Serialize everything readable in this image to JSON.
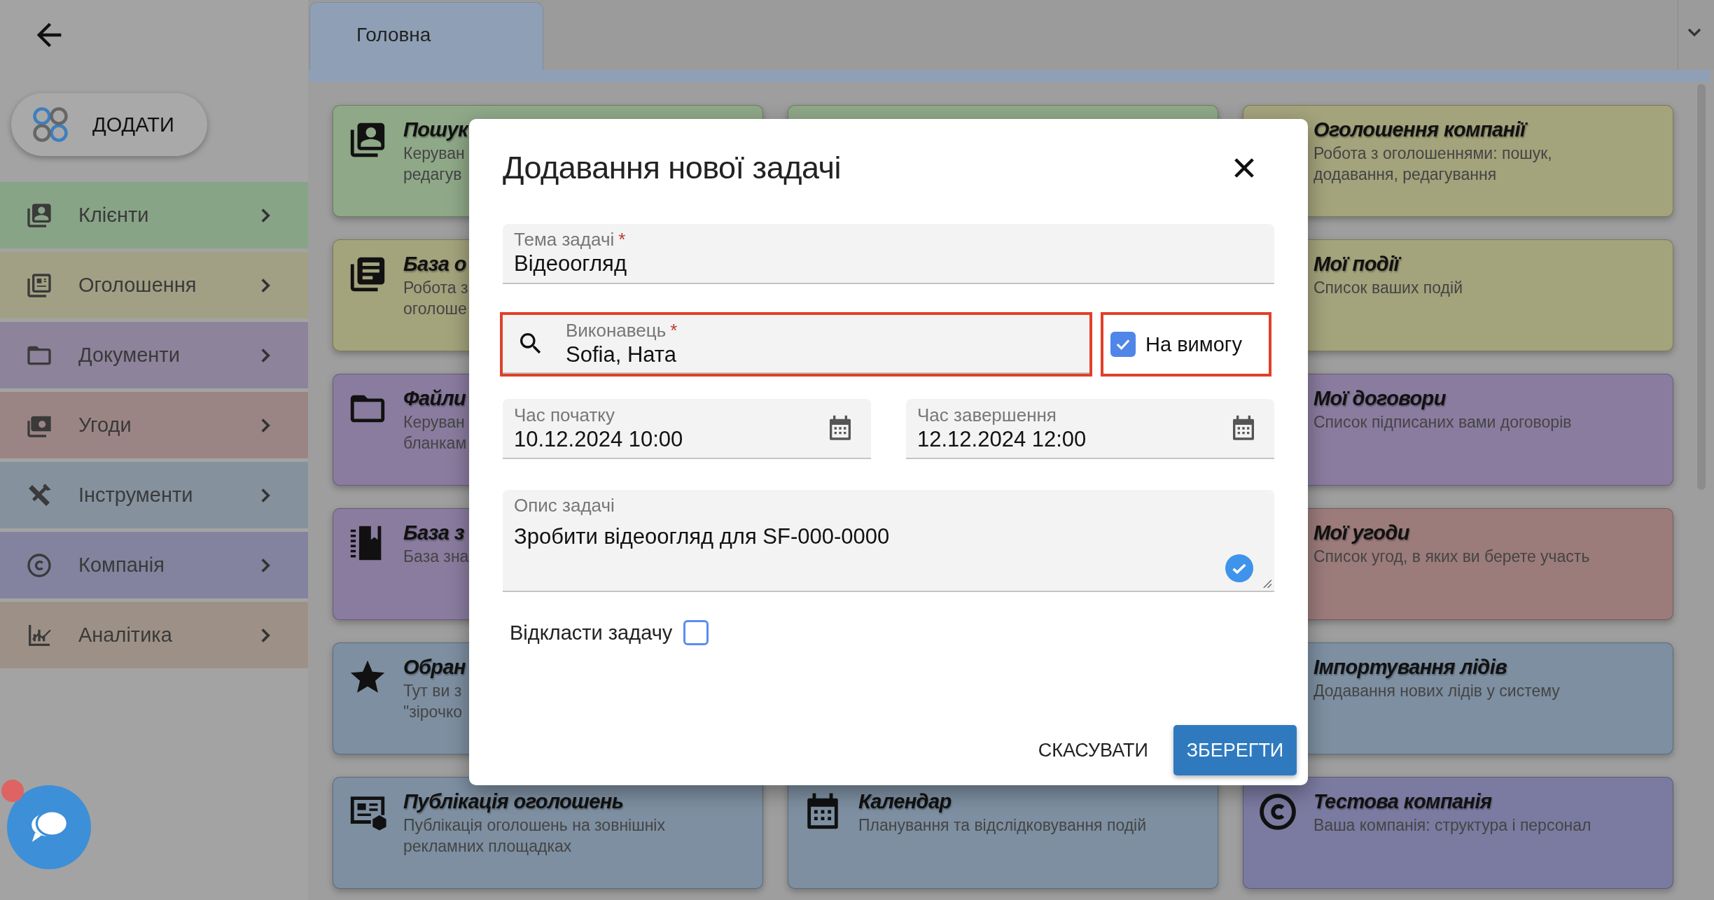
{
  "add_button": {
    "label": "ДОДАТИ"
  },
  "sidebar": {
    "items": [
      {
        "label": "Клієнти",
        "color": "#88a487"
      },
      {
        "label": "Оголошення",
        "color": "#a1a084"
      },
      {
        "label": "Документи",
        "color": "#8d839b"
      },
      {
        "label": "Угоди",
        "color": "#9b8584"
      },
      {
        "label": "Інструменти",
        "color": "#85919d"
      },
      {
        "label": "Компанія",
        "color": "#83839f"
      },
      {
        "label": "Аналітика",
        "color": "#9d9187"
      }
    ]
  },
  "tabs": [
    {
      "label": "Головна",
      "selected": true
    }
  ],
  "card_columns": [
    [
      {
        "title": "Пошук",
        "lines": [
          "Керуван",
          "редагув"
        ],
        "color": "#8fa888"
      },
      {
        "title": "База о",
        "lines": [
          "Робота з",
          "оголоше"
        ],
        "color": "#a3a37c"
      },
      {
        "title": "Файли",
        "lines": [
          "Керуван",
          "бланкам"
        ],
        "color": "#8a7c9f"
      },
      {
        "title": "База з",
        "lines": [
          "База зна"
        ],
        "color": "#8a7c9f"
      },
      {
        "title": "Обран",
        "lines": [
          "Тут ви з",
          "\"зірочко"
        ],
        "color": "#7d8fa1"
      },
      {
        "title": "Публікація оголошень",
        "lines": [
          "Публікація оголошень на зовнішніх",
          "рекламних площадках"
        ],
        "color": "#7d8fa1"
      }
    ],
    [
      {
        "color": "#8fa888"
      },
      {
        "title": "Календар",
        "lines": [
          "Планування та відслідковування подій"
        ],
        "color": "#7d8fa1"
      }
    ],
    [
      {
        "title": "Оголошення компанії",
        "lines": [
          "Робота з оголошеннями: пошук,",
          "додавання, редагування"
        ],
        "color": "#a3a37c"
      },
      {
        "title": "Мої події",
        "lines": [
          "Список ваших подій"
        ],
        "color": "#a3a37c"
      },
      {
        "title": "Мої договори",
        "lines": [
          "Список підписаних вами договорів"
        ],
        "color": "#8a7c9f"
      },
      {
        "title": "Мої угоди",
        "lines": [
          "Список угод, в яких ви берете участь"
        ],
        "color": "#9c7b7b"
      },
      {
        "title": "Імпортування лідів",
        "lines": [
          "Додавання нових лідів у систему"
        ],
        "color": "#7d8fa1"
      },
      {
        "title": "Тестова компанія",
        "lines": [
          "Ваша компанія: структура і персонал"
        ],
        "color": "#7b7aa0"
      }
    ]
  ],
  "dialog": {
    "title": "Додавання нової задачі",
    "topic": {
      "label": "Тема задачі",
      "required_mark": "*",
      "value": "Відеоогляд"
    },
    "assignee": {
      "label": "Виконавець",
      "required_mark": "*",
      "value": "Sofia, Ната",
      "highlighted": true
    },
    "on_demand": {
      "label": "На вимогу",
      "checked": true,
      "highlighted": true
    },
    "start": {
      "label": "Час початку",
      "value": "10.12.2024 10:00"
    },
    "end": {
      "label": "Час завершення",
      "value": "12.12.2024 12:00"
    },
    "description": {
      "label": "Опис задачі",
      "value": "Зробити відеоогляд для SF-000-0000"
    },
    "postpone": {
      "label": "Відкласти задачу",
      "checked": false
    },
    "cancel_button": {
      "label": "СКАСУВАТИ"
    },
    "save_button": {
      "label": "ЗБЕРЕГТИ"
    }
  }
}
